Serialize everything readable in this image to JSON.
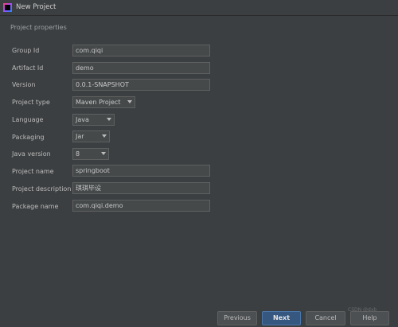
{
  "window": {
    "title": "New Project"
  },
  "section_title": "Project properties",
  "fields": [
    {
      "label": "Group Id",
      "value": "com.qiqi",
      "type": "text"
    },
    {
      "label": "Artifact Id",
      "value": "demo",
      "type": "text"
    },
    {
      "label": "Version",
      "value": "0.0.1-SNAPSHOT",
      "type": "text"
    },
    {
      "label": "Project type",
      "value": "Maven Project",
      "type": "select"
    },
    {
      "label": "Language",
      "value": "Java",
      "type": "select"
    },
    {
      "label": "Packaging",
      "value": "Jar",
      "type": "select"
    },
    {
      "label": "Java version",
      "value": "8",
      "type": "select"
    },
    {
      "label": "Project name",
      "value": "springboot",
      "type": "text"
    },
    {
      "label": "Project description",
      "value": "琪琪毕设",
      "type": "text"
    },
    {
      "label": "Package name",
      "value": "com.qiqi.demo",
      "type": "text"
    }
  ],
  "buttons": {
    "previous": "Previous",
    "next": "Next",
    "cancel": "Cancel",
    "help": "Help"
  },
  "watermark": "CSDN @dxb",
  "icons": {
    "app": "intellij-idea-icon",
    "dropdown": "chevron-down-icon"
  },
  "colors": {
    "background": "#3c3f41",
    "field_bg": "#45494a",
    "primary_button": "#365880"
  }
}
